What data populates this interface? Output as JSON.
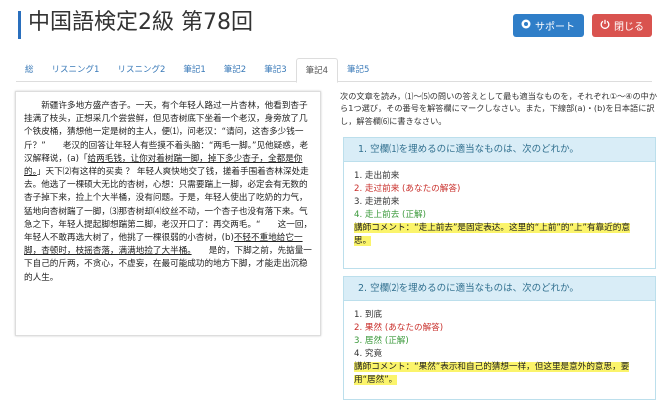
{
  "header": {
    "title": "中国語検定2級 第78回",
    "support_label": "サポート",
    "close_label": "閉じる",
    "support_icon": "chat-icon",
    "close_icon": "power-icon"
  },
  "tabs": [
    {
      "label": "総"
    },
    {
      "label": "リスニング1"
    },
    {
      "label": "リスニング2"
    },
    {
      "label": "筆記1"
    },
    {
      "label": "筆記2"
    },
    {
      "label": "筆記3"
    },
    {
      "label": "筆記4"
    },
    {
      "label": "筆記5"
    }
  ],
  "active_tab": "筆記4",
  "passage": {
    "p1": "　　新疆许多地方盛产杏子。一天，有个年轻人路过一片杏林，他看到杏子挂满了枝头，正想采几个尝尝鲜，但见杏树底下坐着一个老汉，身旁放了几个铁皮桶，猜想他一定是树的主人，便⑴，问老汉：“请问，这杏多少钱一斤？”　　老汉的回答让年轻人有些摸不着头脑：“两毛一脚。”见他疑惑，老汉解释说，(a)「",
    "p1_u": "给两毛钱，让你对着树踹一脚，掉下多少杏子，全都是你的。",
    "p2": "」天下⑵有这样的买卖 ？ 年轻人爽快地交了钱，搓着手围着杏林深处走去。他选了一棵硕大无比的杏树，心想：只需要踹上一脚，必定会有无数的杏子掉下来，捡上个大半桶，没有问题。于是，年轻人使出了吃奶的力气，猛地向杏树踹了一脚，⑶那杏树却⑷纹丝不动，一个杏子也没有落下来。气急之下，年轻人提起脚想踹第二脚，老汉开口了：再交两毛。“　　这一回，年轻人不敢再选大树了，他挑了一棵很弱的小杏树，(b)",
    "p2_u": "不轻不重地给它一脚，杏顿时，枝摇杏落，满满地捡了大半桶。",
    "p3": "　　是的，下脚之前，先掂量一下自己的斤两，不贪心，不虚妄，在最可能成功的地方下脚，才能走出沉稳的人生。"
  },
  "instructions": "次の文章を読み，⑴～⑸の問いの答えとして最も適当なものを，それぞれ①～④の中から1つ選び，その番号を解答欄にマークしなさい。また，下線部(a)・(b)を日本語に訳し，解答欄⑹に書きなさい。",
  "questions": [
    {
      "heading": "1. 空欄⑴を埋めるのに適当なものは、次のどれか。",
      "options": [
        {
          "text": "1. 走出前来",
          "state": "normal"
        },
        {
          "text": "2. 走过前来 (あなたの解答)",
          "state": "wrong"
        },
        {
          "text": "3. 走进前来",
          "state": "normal"
        },
        {
          "text": "4. 走上前去 (正解)",
          "state": "correct"
        }
      ],
      "comment": "講師コメント：“走上前去”是固定表达。这里的“上前”的“上”有靠近的意思。"
    },
    {
      "heading": "2. 空欄⑵を埋めるのに適当なものは、次のどれか。",
      "options": [
        {
          "text": "1. 到底",
          "state": "normal"
        },
        {
          "text": "2. 果然 (あなたの解答)",
          "state": "wrong"
        },
        {
          "text": "3. 居然 (正解)",
          "state": "correct"
        },
        {
          "text": "4. 究竟",
          "state": "normal"
        }
      ],
      "comment": "講師コメント：“果然”表示和自己的猜想一样，但这里是意外的意思，要用“居然”。"
    }
  ]
}
